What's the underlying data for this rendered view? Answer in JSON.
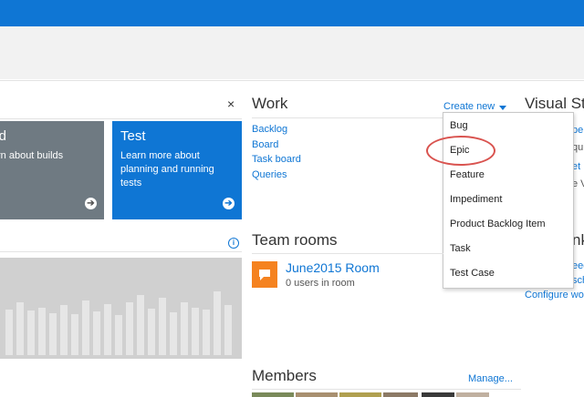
{
  "build_tile": {
    "title": "ild",
    "description": "rn about builds"
  },
  "test_tile": {
    "title": "Test",
    "description": "Learn more about planning and running tests"
  },
  "close_glyph": "×",
  "arrow_glyph": "➔",
  "info_glyph": "i",
  "work": {
    "title": "Work",
    "create_new": "Create new",
    "links": [
      "Backlog",
      "Board",
      "Task board",
      "Queries"
    ]
  },
  "create_menu": {
    "items": [
      "Bug",
      "Epic",
      "Feature",
      "Impediment",
      "Product Backlog Item",
      "Task",
      "Test Case"
    ],
    "highlighted": "Epic"
  },
  "team_rooms": {
    "title": "Team rooms",
    "room_name": "June2015 Room",
    "room_users": "0 users in room"
  },
  "members": {
    "title": "Members",
    "manage": "Manage..."
  },
  "right_column": {
    "title": "Visual Stu",
    "fragments": [
      "pe",
      "qui",
      "et",
      "e V",
      "nk",
      "eed",
      "sch"
    ],
    "configure": "Configure wo"
  },
  "colors": {
    "topbar": "#0f76d4",
    "accent": "#0f76d4",
    "build_tile": "#6f7a82",
    "room_icon": "#f5821f",
    "highlight_ring": "#d9534f"
  }
}
